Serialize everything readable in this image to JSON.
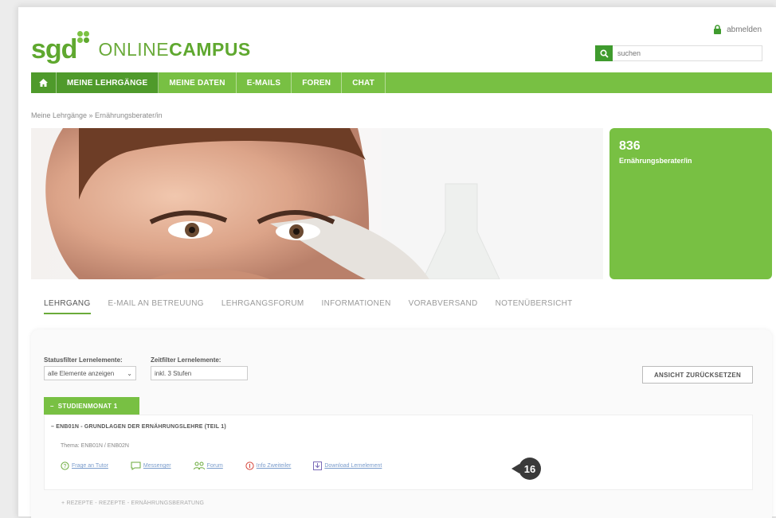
{
  "header": {
    "logo_sgd": "sgd",
    "logo_online": "ONLINE",
    "logo_campus": "CAMPUS",
    "logout": "abmelden",
    "search_placeholder": "suchen"
  },
  "nav": {
    "items": [
      {
        "label": "MEINE LEHRGÄNGE"
      },
      {
        "label": "MEINE DATEN"
      },
      {
        "label": "E-MAILS"
      },
      {
        "label": "FOREN"
      },
      {
        "label": "CHAT"
      }
    ]
  },
  "breadcrumb": "Meine Lehrgänge  »  Ernährungsberater/in",
  "course": {
    "number": "836",
    "title": "Ernährungsberater/in"
  },
  "tabs": [
    {
      "label": "LEHRGANG"
    },
    {
      "label": "E-MAIL AN BETREUUNG"
    },
    {
      "label": "LEHRGANGSFORUM"
    },
    {
      "label": "INFORMATIONEN"
    },
    {
      "label": "VORABVERSAND"
    },
    {
      "label": "NOTENÜBERSICHT"
    }
  ],
  "filters": {
    "status_label": "Statusfilter Lernelemente:",
    "status_value": "alle Elemente anzeigen",
    "time_label": "Zeitfilter Lernelemente:",
    "time_value": "inkl. 3 Stufen",
    "reset_button": "ANSICHT ZURÜCKSETZEN"
  },
  "month": {
    "label": "STUDIENMONAT 1"
  },
  "module": {
    "title": "ENB01N - GRUNDLAGEN DER ERNÄHRUNGSLEHRE (TEIL 1)",
    "subtitle": "Thema: ENB01N / ENB02N",
    "actions": [
      {
        "label": "Frage an Tutor",
        "icon": "question-icon"
      },
      {
        "label": "Messenger",
        "icon": "speech-bubble-icon"
      },
      {
        "label": "Forum",
        "icon": "people-icon"
      },
      {
        "label": "Info Zweiteiler",
        "icon": "info-icon"
      },
      {
        "label": "Download Lernelement",
        "icon": "download-icon"
      }
    ],
    "callout": "16"
  },
  "next_module": "REZEPTE - REZEPTE - ERNÄHRUNGSBERATUNG",
  "colors": {
    "brand_green": "#78c043",
    "dark_green": "#4f9a2b",
    "badge": "#3a3a3a"
  }
}
